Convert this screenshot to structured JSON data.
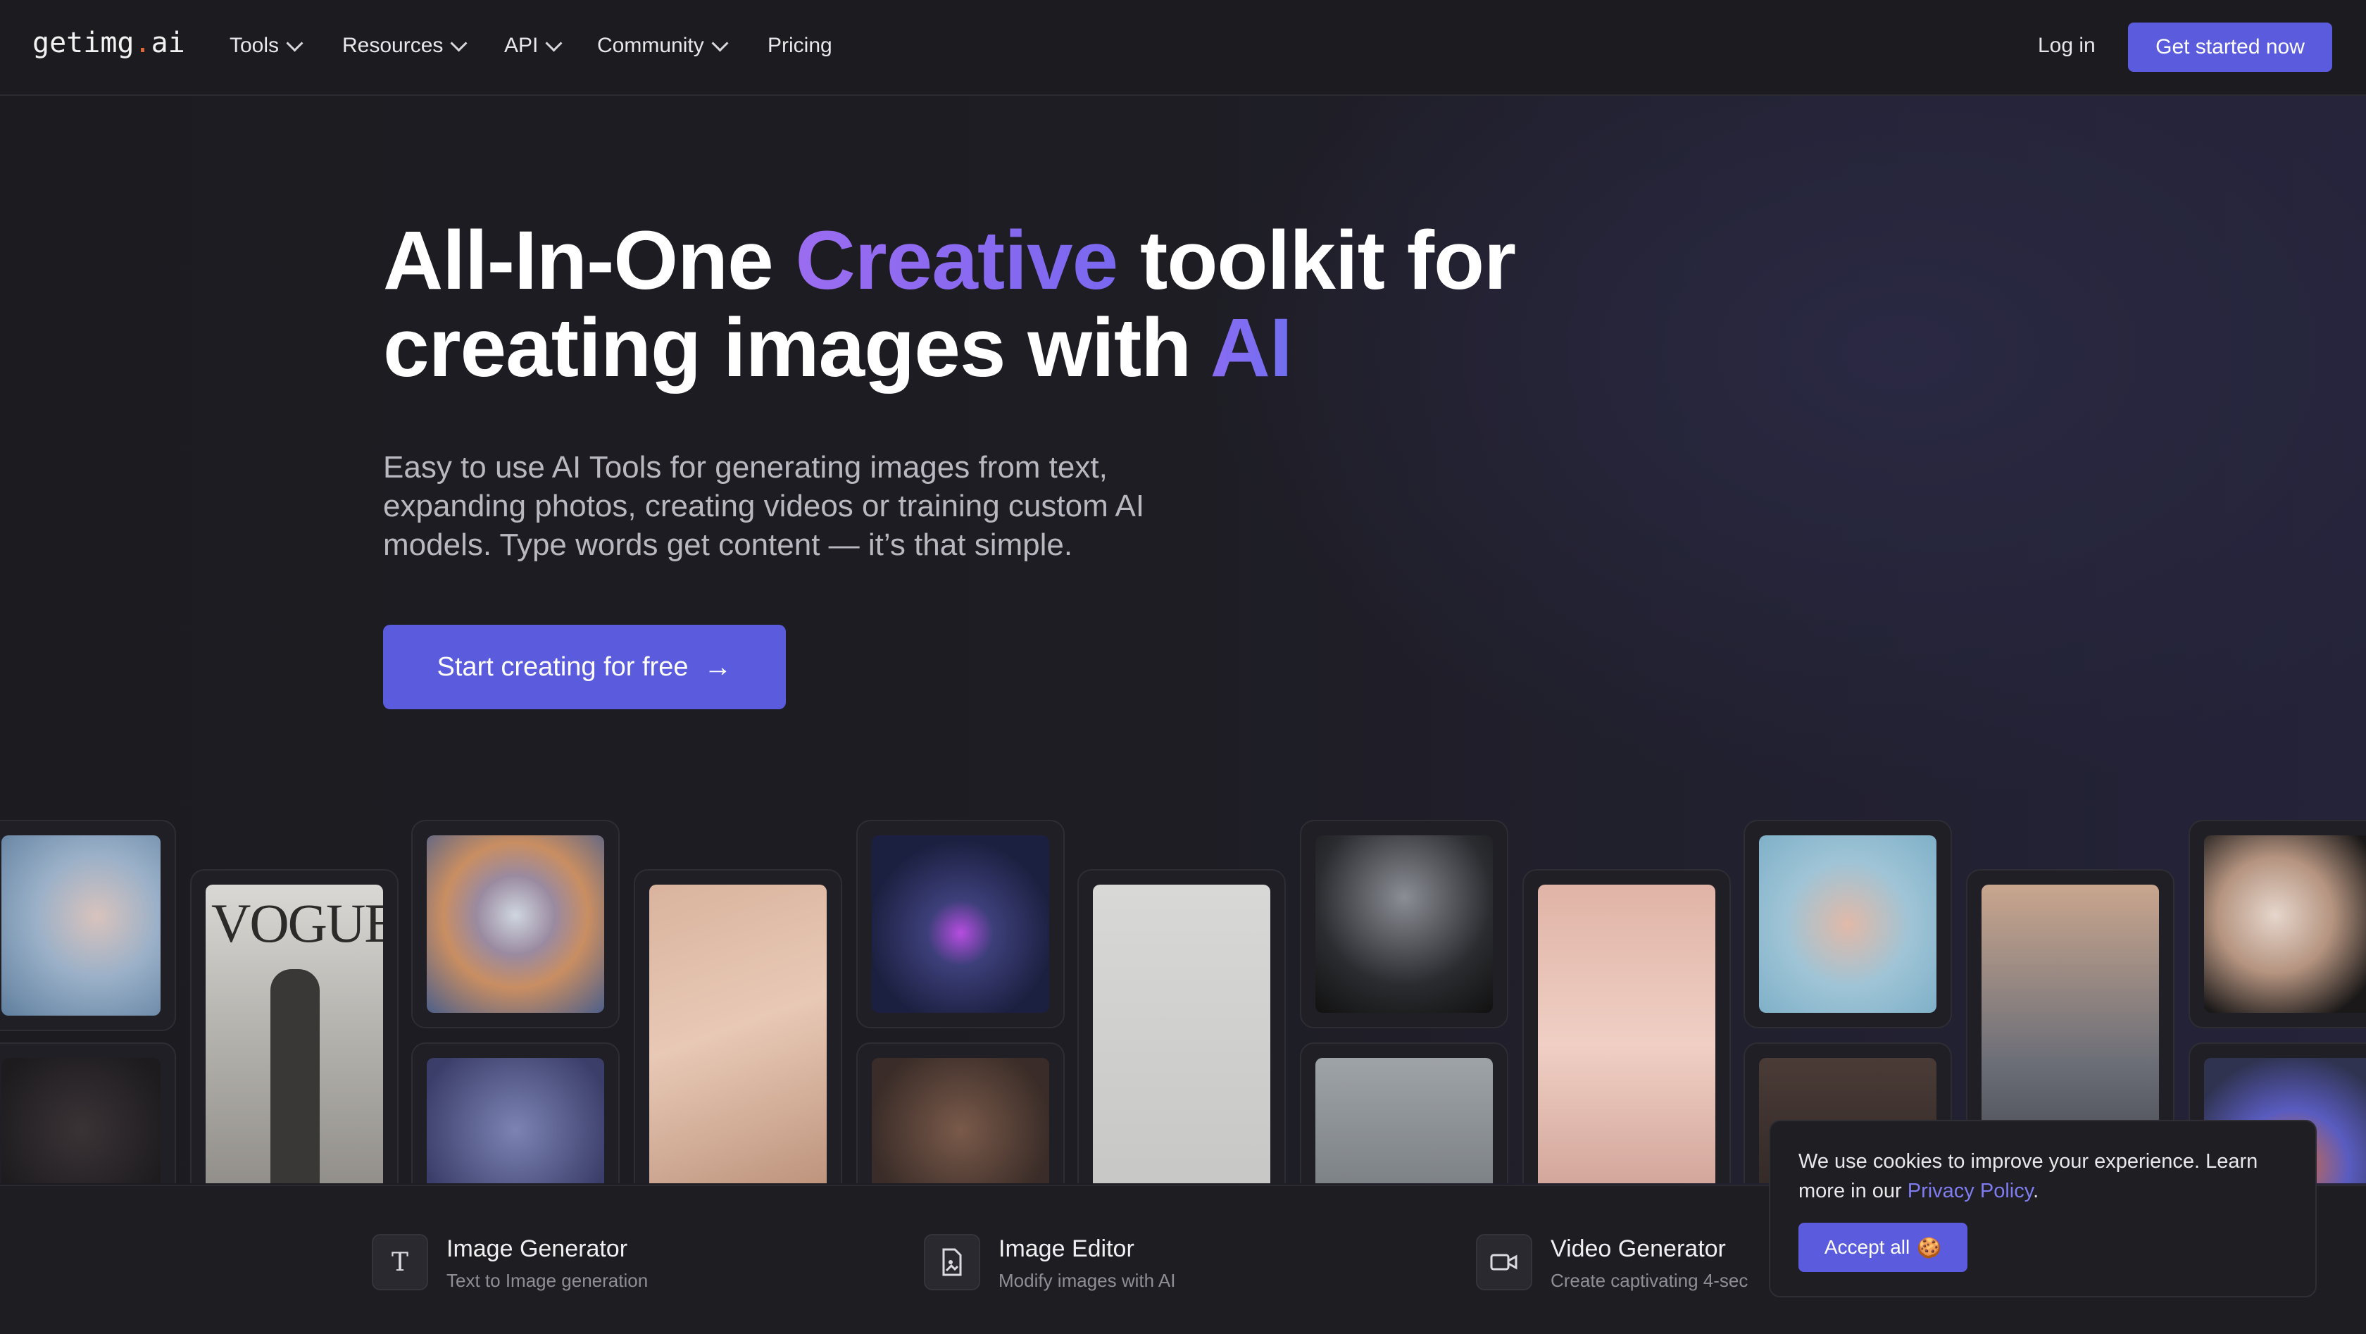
{
  "nav": {
    "logo_main": "getimg",
    "logo_dot": ".",
    "logo_tld": "ai",
    "items": [
      {
        "label": "Tools",
        "has_dropdown": true
      },
      {
        "label": "Resources",
        "has_dropdown": true
      },
      {
        "label": "API",
        "has_dropdown": true
      },
      {
        "label": "Community",
        "has_dropdown": true
      },
      {
        "label": "Pricing",
        "has_dropdown": false
      }
    ],
    "login": "Log in",
    "cta": "Get started now"
  },
  "hero": {
    "title_part1": "All-In-One ",
    "title_highlight1": "Creative",
    "title_part2": " toolkit for creating images with ",
    "title_highlight2": "AI",
    "subtitle": "Easy to use AI Tools for generating images from text, expanding photos, creating videos or training custom AI models. Type words get content — it’s that simple.",
    "cta": "Start creating for free",
    "cta_icon": "arrow-right-icon"
  },
  "gallery": {
    "vogue_text": "VOGUE"
  },
  "tools": [
    {
      "icon": "text-icon",
      "glyph": "T",
      "title": "Image Generator",
      "subtitle": "Text to Image generation"
    },
    {
      "icon": "image-edit-icon",
      "glyph": "🖻",
      "title": "Image Editor",
      "subtitle": "Modify images with AI"
    },
    {
      "icon": "video-icon",
      "glyph": "▭",
      "title": "Video Generator",
      "subtitle": "Create captivating 4-sec"
    }
  ],
  "cookie": {
    "text": "We use cookies to improve your experience. Learn more in our ",
    "link": "Privacy Policy",
    "period": ".",
    "button": "Accept all",
    "button_icon": "cookie-icon"
  },
  "colors": {
    "accent": "#5b5bde",
    "background": "#1c1b20",
    "logo_dot": "#e0683c"
  }
}
